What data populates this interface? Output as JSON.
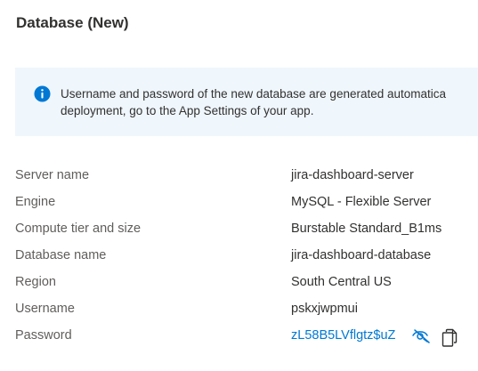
{
  "section": {
    "title": "Database (New)"
  },
  "info": {
    "icon": "info-icon",
    "color": "#0078d4",
    "line1": "Username and password of the new database are generated automatica",
    "line2": "deployment, go to the App Settings of your app."
  },
  "details": {
    "server_name": {
      "label": "Server name",
      "value": "jira-dashboard-server"
    },
    "engine": {
      "label": "Engine",
      "value": "MySQL - Flexible Server"
    },
    "compute": {
      "label": "Compute tier and size",
      "value": "Burstable Standard_B1ms"
    },
    "database_name": {
      "label": "Database name",
      "value": "jira-dashboard-database"
    },
    "region": {
      "label": "Region",
      "value": "South Central US"
    },
    "username": {
      "label": "Username",
      "value": "pskxjwpmui"
    },
    "password": {
      "label": "Password",
      "value": "zL58B5LVflgtz$uZ",
      "reveal_icon": "eye-hide-icon",
      "copy_icon": "copy-icon"
    }
  }
}
